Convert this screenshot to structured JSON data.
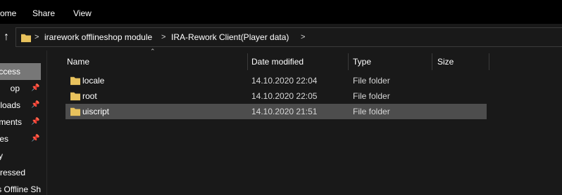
{
  "ribbon": {
    "tabs": [
      "ome",
      "Share",
      "View"
    ]
  },
  "address": {
    "up_icon": "up-arrow-icon",
    "crumbs": [
      "irarework offlineshop module",
      "IRA-Rework Client(Player data)"
    ],
    "separator": ">"
  },
  "nav": {
    "items": [
      {
        "label": "ccess",
        "pinned": false,
        "active": true
      },
      {
        "label": "op",
        "pinned": true,
        "active": false
      },
      {
        "label": "loads",
        "pinned": true,
        "active": false
      },
      {
        "label": "ments",
        "pinned": true,
        "active": false
      },
      {
        "label": "res",
        "pinned": true,
        "active": false
      },
      {
        "label": "y",
        "pinned": false,
        "active": false
      },
      {
        "label": "ressed",
        "pinned": false,
        "active": false
      },
      {
        "label": "s Offline Sh",
        "pinned": false,
        "active": false
      }
    ]
  },
  "columns": {
    "name": "Name",
    "date": "Date modified",
    "type": "Type",
    "size": "Size"
  },
  "files": [
    {
      "name": "locale",
      "date": "14.10.2020 22:04",
      "type": "File folder",
      "size": "",
      "selected": false
    },
    {
      "name": "root",
      "date": "14.10.2020 22:05",
      "type": "File folder",
      "size": "",
      "selected": false
    },
    {
      "name": "uiscript",
      "date": "14.10.2020 21:51",
      "type": "File folder",
      "size": "",
      "selected": true
    }
  ],
  "colors": {
    "background": "#191919",
    "ribbon": "#000000",
    "selected_row": "#4d4d4d",
    "folder": "#e8c25d"
  }
}
